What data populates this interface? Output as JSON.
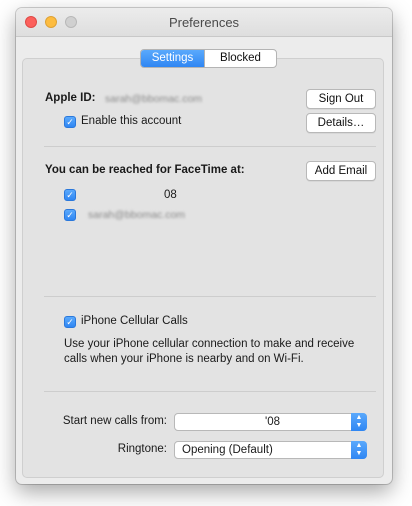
{
  "window": {
    "title": "Preferences"
  },
  "tabs": {
    "settings_label": "Settings",
    "blocked_label": "Blocked",
    "active": "Settings"
  },
  "account": {
    "apple_id_label": "Apple ID:",
    "apple_id_value": "sarah@bbomac.com",
    "sign_out_label": "Sign Out",
    "enable_label": "Enable this account",
    "enable_checked": true,
    "details_label": "Details…"
  },
  "reach": {
    "heading": "You can be reached for FaceTime at:",
    "add_email_label": "Add Email",
    "entries": [
      {
        "value": "08",
        "checked": true
      },
      {
        "value": "sarah@bbomac.com",
        "checked": true
      }
    ]
  },
  "cellular": {
    "label": "iPhone Cellular Calls",
    "checked": true,
    "description": "Use your iPhone cellular connection to make and receive calls when your iPhone is nearby and on Wi-Fi."
  },
  "calls": {
    "start_from_label": "Start new calls from:",
    "start_from_value": "'08",
    "ringtone_label": "Ringtone:",
    "ringtone_value": "Opening (Default)"
  },
  "colors": {
    "accent": "#2f86f3",
    "close": "#fc605c",
    "minimize": "#fdbc40"
  }
}
